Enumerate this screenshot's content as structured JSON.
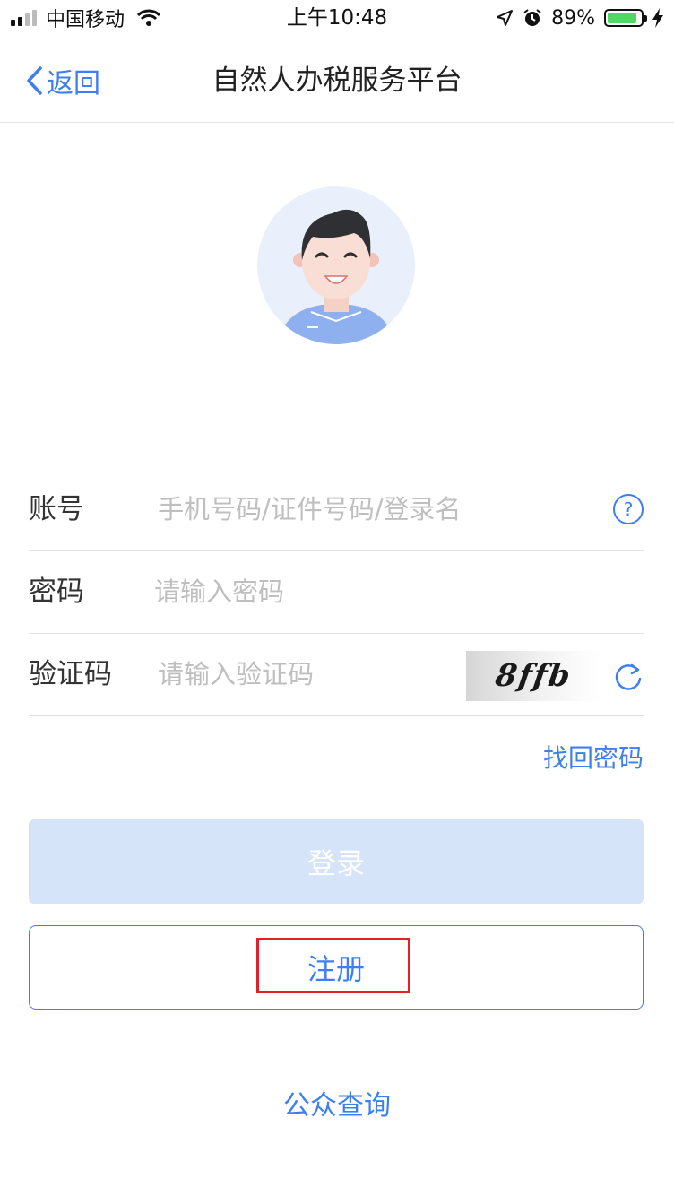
{
  "status_bar": {
    "carrier": "中国移动",
    "time": "上午10:48",
    "battery_percent": "89%",
    "battery_level": 0.89,
    "battery_color": "#4cd964"
  },
  "nav": {
    "back_label": "返回",
    "title": "自然人办税服务平台"
  },
  "form": {
    "account_label": "账号",
    "account_placeholder": "手机号码/证件号码/登录名",
    "password_label": "密码",
    "password_placeholder": "请输入密码",
    "captcha_label": "验证码",
    "captcha_placeholder": "请输入验证码",
    "captcha_text": "8ffb",
    "help_symbol": "?"
  },
  "forgot_password": "找回密码",
  "login_button": "登录",
  "register_button": "注册",
  "public_query": "公众查询",
  "colors": {
    "accent": "#3d7ff0",
    "login_disabled_bg": "#d6e4f9",
    "highlight": "#e0212a"
  }
}
